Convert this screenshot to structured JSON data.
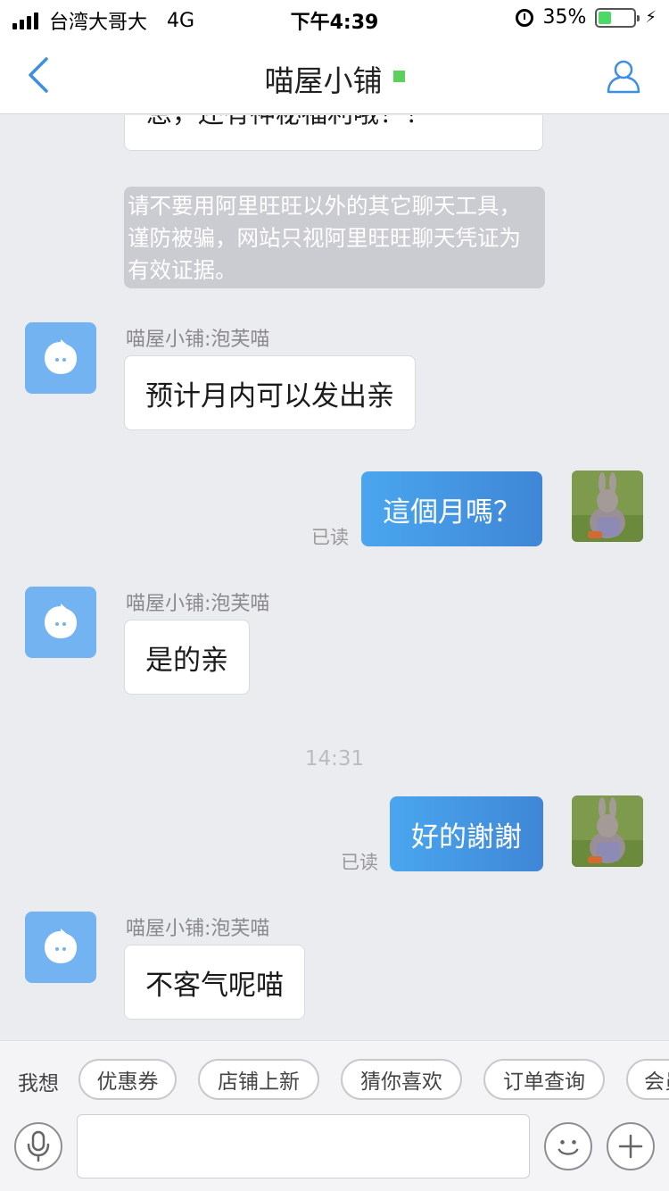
{
  "status_bar": {
    "carrier": "台湾大哥大",
    "network": "4G",
    "time": "下午4:39",
    "battery_percent": "35%",
    "battery_level": 0.35
  },
  "nav": {
    "title": "喵屋小铺",
    "online_color": "#5bd15b"
  },
  "chat": {
    "partial_text": "息，还有神秘福利哦！！",
    "notice": "请不要用阿里旺旺以外的其它聊天工具，谨防被骗，网站只视阿里旺旺聊天凭证为有效证据。",
    "messages": [
      {
        "sender": "喵屋小铺:泡芙喵",
        "text": "预计月内可以发出亲"
      },
      {
        "text": "這個月嗎？",
        "status": "已读"
      },
      {
        "sender": "喵屋小铺:泡芙喵",
        "text": "是的亲"
      },
      {
        "timestamp": "14:31"
      },
      {
        "text": "好的謝謝",
        "status": "已读"
      },
      {
        "sender": "喵屋小铺:泡芙喵",
        "text": "不客气呢喵"
      }
    ]
  },
  "quick_bar": {
    "label": "我想",
    "chips": [
      "优惠券",
      "店铺上新",
      "猜你喜欢",
      "订单查询",
      "会员"
    ]
  },
  "input": {
    "placeholder": ""
  },
  "colors": {
    "accent": "#4a90e2",
    "outgoing_bubble": "#4aa6ef",
    "avatar_bg": "#73b3f1",
    "background": "#ebecf0"
  },
  "icons": [
    "back-chevron-icon",
    "profile-icon",
    "microphone-icon",
    "emoji-icon",
    "plus-icon",
    "wangwang-avatar-icon",
    "alarm-icon",
    "battery-icon",
    "signal-icon"
  ]
}
